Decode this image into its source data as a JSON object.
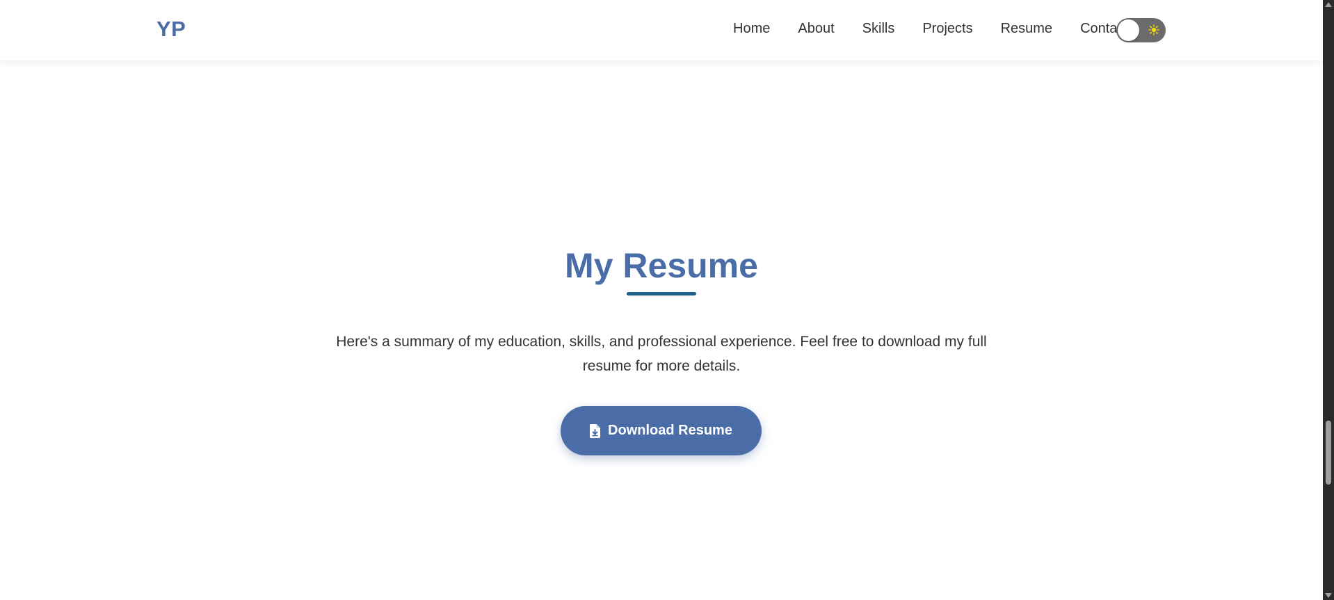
{
  "header": {
    "logo": "YP",
    "nav": [
      {
        "label": "Home"
      },
      {
        "label": "About"
      },
      {
        "label": "Skills"
      },
      {
        "label": "Projects"
      },
      {
        "label": "Resume"
      },
      {
        "label": "Contact"
      }
    ],
    "theme_toggle": {
      "state": "light",
      "icon": "sun-icon",
      "icon_color": "#f5d90a"
    }
  },
  "resume": {
    "title": "My Resume",
    "description": "Here's a summary of my education, skills, and professional experience. Feel free to download my full resume for more details.",
    "download_label": "Download Resume",
    "download_icon": "file-download-icon"
  },
  "colors": {
    "accent": "#4a6da7",
    "underline": "#1e5f8a",
    "text": "#333333",
    "background": "#ffffff"
  }
}
